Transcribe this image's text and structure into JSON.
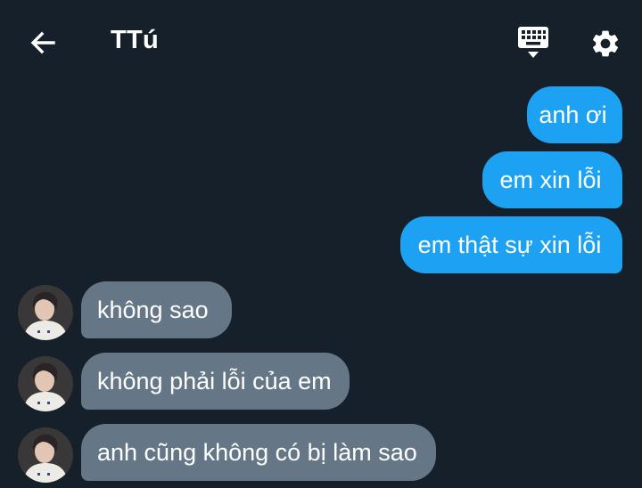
{
  "header": {
    "back_icon": "arrow-left-icon",
    "title": "TTú",
    "keyboard_icon": "keyboard-icon",
    "settings_icon": "gear-icon"
  },
  "messages": [
    {
      "direction": "outgoing",
      "text": "anh ơi"
    },
    {
      "direction": "outgoing",
      "text": "em xin lỗi"
    },
    {
      "direction": "outgoing",
      "text": "em thật sự xin lỗi"
    },
    {
      "direction": "incoming",
      "text": "không sao"
    },
    {
      "direction": "incoming",
      "text": "không phải lỗi của em"
    },
    {
      "direction": "incoming",
      "text": "anh cũng không có bị làm sao"
    }
  ],
  "colors": {
    "background": "#15202b",
    "outgoing_bubble": "#1da1f2",
    "incoming_bubble": "#657786",
    "text": "#ffffff"
  }
}
